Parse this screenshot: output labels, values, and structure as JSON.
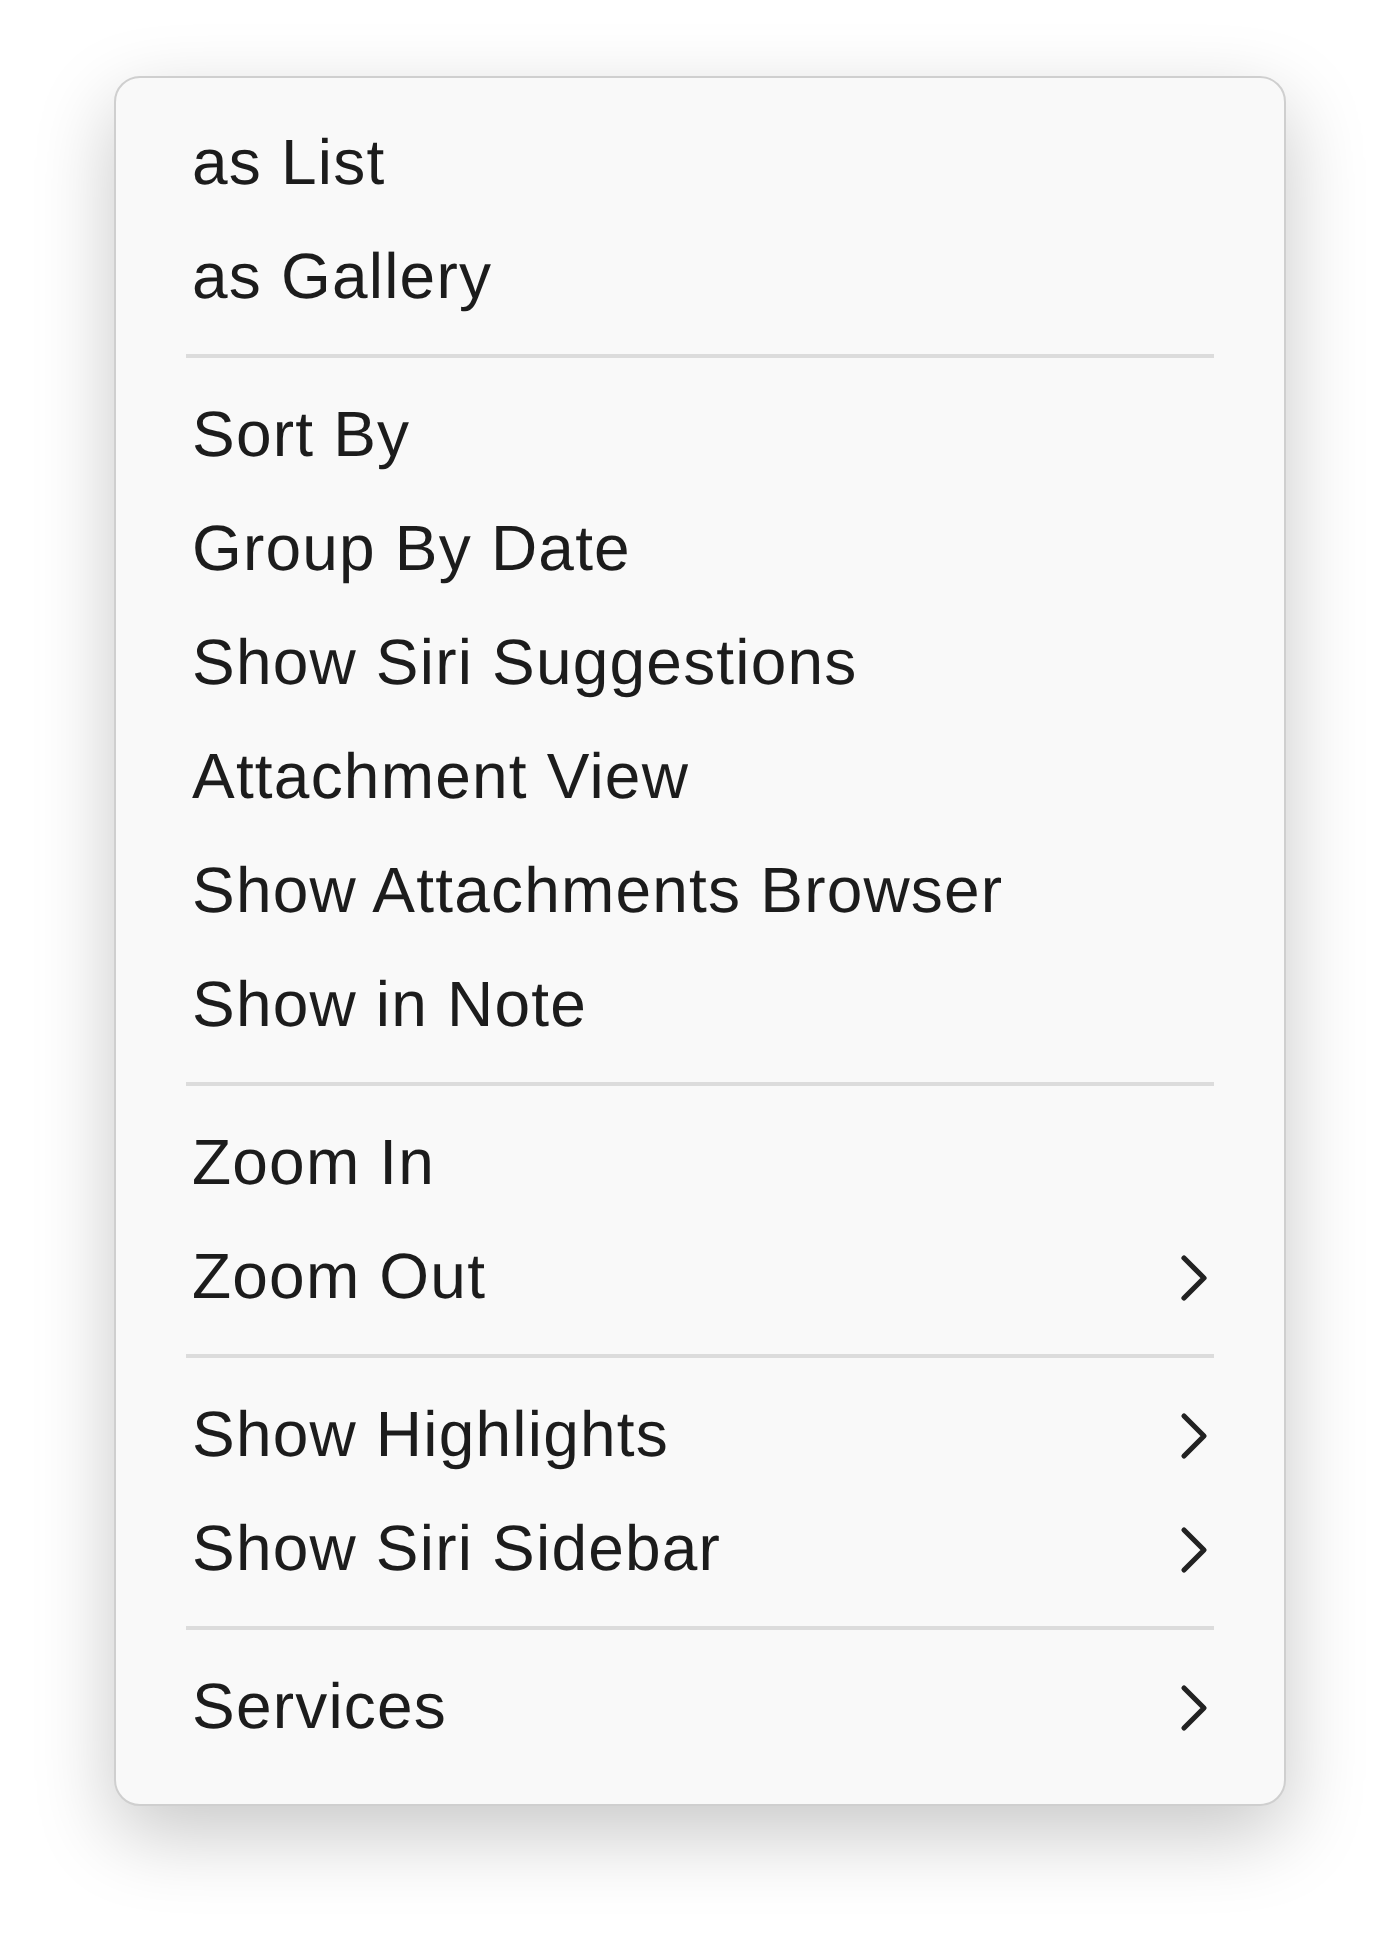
{
  "menu": {
    "sections": [
      {
        "items": [
          {
            "label": "as List",
            "submenu": false
          },
          {
            "label": "as Gallery",
            "submenu": false
          }
        ]
      },
      {
        "items": [
          {
            "label": "Sort By",
            "submenu": false
          },
          {
            "label": "Group By Date",
            "submenu": false
          },
          {
            "label": "Show Siri Suggestions",
            "submenu": false
          },
          {
            "label": "Attachment View",
            "submenu": false
          },
          {
            "label": "Show Attachments Browser",
            "submenu": false
          },
          {
            "label": "Show in Note",
            "submenu": false
          }
        ]
      },
      {
        "items": [
          {
            "label": "Zoom In",
            "submenu": false
          },
          {
            "label": "Zoom Out",
            "submenu": true
          }
        ]
      },
      {
        "items": [
          {
            "label": "Show Highlights",
            "submenu": true
          },
          {
            "label": "Show Siri Sidebar",
            "submenu": true
          }
        ]
      },
      {
        "items": [
          {
            "label": "Services",
            "submenu": true
          }
        ]
      }
    ]
  }
}
